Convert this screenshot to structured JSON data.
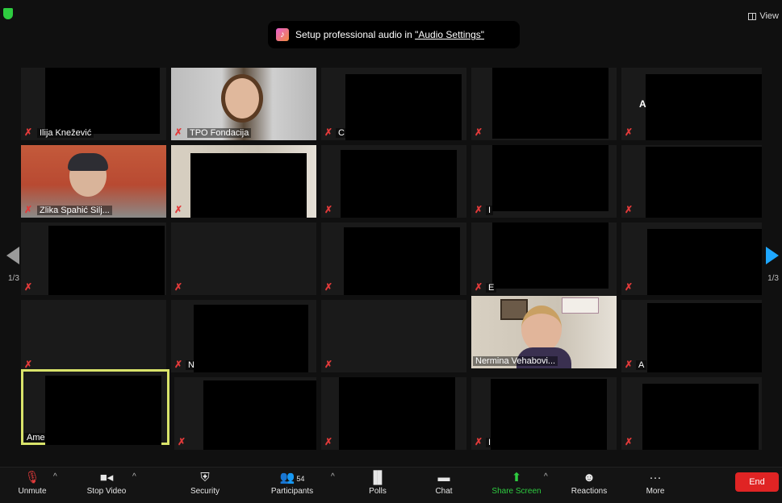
{
  "window": {
    "view_label": "View"
  },
  "banner": {
    "text": "Setup professional audio in ",
    "link": "\"Audio Settings\""
  },
  "pagination": {
    "left": "1/3",
    "right": "1/3"
  },
  "participants": {
    "r1c1": "Ilija Knežević",
    "r1c2": "TPO Fondacija",
    "r1c3": "C",
    "r1c5": "A",
    "r2c1": "Zlika Spahić Silj...",
    "r2c4": "I",
    "r3c4": "E",
    "r4c2": "N",
    "r4c4": "Nermina Vehabovi...",
    "r4c5": "A",
    "r5c1": "Ame",
    "r5c4": "I"
  },
  "toolbar": {
    "unmute": "Unmute",
    "stop_video": "Stop Video",
    "security": "Security",
    "participants": "Participants",
    "participants_count": "54",
    "polls": "Polls",
    "chat": "Chat",
    "share_screen": "Share Screen",
    "reactions": "Reactions",
    "more": "More",
    "end": "End"
  },
  "colors": {
    "accent": "#1ea7ff",
    "share_green": "#2ecc40",
    "end_red": "#e02424",
    "muted_red": "#e23a3a",
    "selected_outline": "#d9e36a"
  }
}
